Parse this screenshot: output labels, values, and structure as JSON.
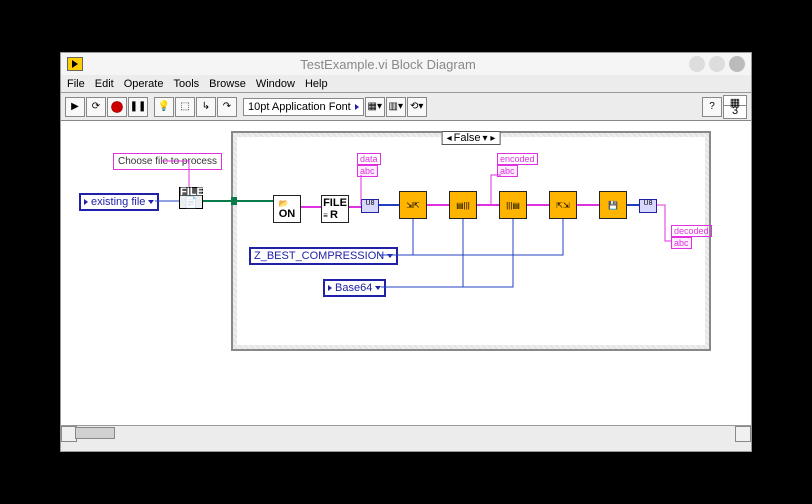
{
  "window": {
    "title": "TestExample.vi Block Diagram",
    "menu": [
      "File",
      "Edit",
      "Operate",
      "Tools",
      "Browse",
      "Window",
      "Help"
    ],
    "font": "10pt Application Font",
    "right_count": "3"
  },
  "labels": {
    "choose": "Choose file to process",
    "existing": "existing file",
    "data": "data",
    "encoded": "encoded",
    "decoded": "decoded",
    "compression": "Z_BEST_COMPRESSION",
    "base64": "Base64",
    "casesel": "False",
    "abc": "abc",
    "file": "FILE",
    "readR": "R",
    "on": "ON"
  }
}
